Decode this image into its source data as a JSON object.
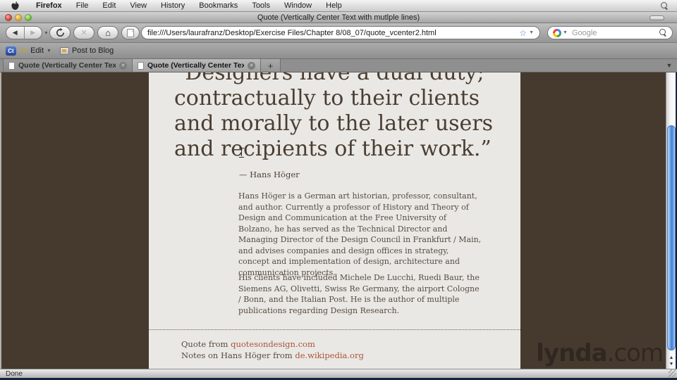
{
  "menu_bar": {
    "app_menu": "Firefox",
    "items": [
      "File",
      "Edit",
      "View",
      "History",
      "Bookmarks",
      "Tools",
      "Window",
      "Help"
    ]
  },
  "window": {
    "title": "Quote (Vertically Center Text with mutlple lines)"
  },
  "toolbar": {
    "url": "file:///Users/laurafranz/Desktop/Exercise Files/Chapter 8/08_07/quote_vcenter2.html",
    "search_placeholder": "Google"
  },
  "bookmarks_bar": {
    "badge": "Ct",
    "edit_label": "Edit",
    "post_label": "Post to Blog"
  },
  "tab_bar": {
    "tabs": [
      {
        "label": "Quote (Vertically Center Text)",
        "active": false
      },
      {
        "label": "Quote (Vertically Center Text w…",
        "active": true
      }
    ],
    "new_tab_label": "+"
  },
  "page": {
    "quote_lines": [
      "“Designers have a dual duty;",
      "contractually to their clients",
      "and morally to the later users",
      "and recipients of their work.”"
    ],
    "attribution": "— Hans Höger",
    "bio": [
      "Hans Höger is a German art historian, professor, consultant, and author. Currently a professor of History and Theory of Design and Communication at the Free University of Bolzano, he has served as the Technical Director and Managing Director of the Design Council in Frankfurt / Main, and advises companies and design offices in strategy, concept and implementation of design, architecture and communication projects.",
      "His clients have included Michele De Lucchi, Ruedi Baur, the Siemens AG, Olivetti, Swiss Re Germany, the airport Cologne / Bonn, and the Italian Post. He is the author of multiple publications regarding Design Research."
    ],
    "footer": {
      "line1_prefix": "Quote from ",
      "line1_link": "quotesondesign.com",
      "line2_prefix": "Notes on Hans Höger from ",
      "line2_link": "de.wikipedia.org"
    },
    "colors": {
      "body_background": "#463a2e",
      "content_background": "#eae8e4",
      "text": "#554b41",
      "quote_text": "#4a3e33",
      "link": "#a9543c"
    }
  },
  "watermark": {
    "brand": "lynda",
    "tld": ".com"
  },
  "status_bar": {
    "text": "Done"
  },
  "glyphs": {
    "back": "◀",
    "forward": "▶",
    "stop": "✕",
    "home": "⌂",
    "star": "☆",
    "dropdown": "▼",
    "close": "✕",
    "scroll_up": "▲",
    "scroll_down": "▼",
    "alltabs": "▼"
  }
}
